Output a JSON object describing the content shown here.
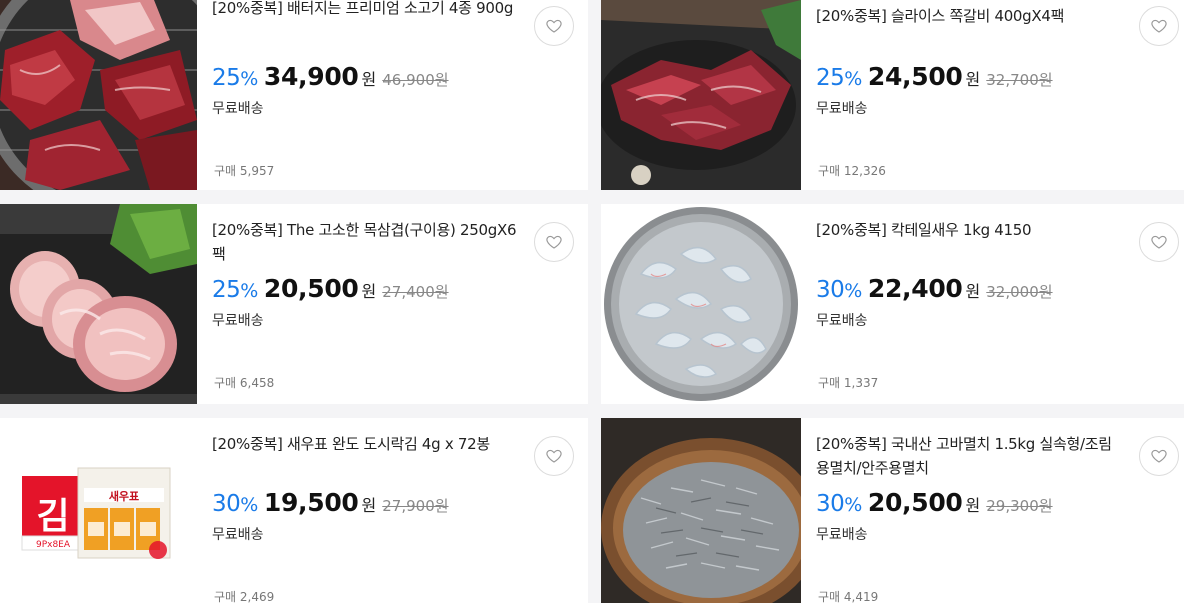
{
  "products": [
    {
      "title": "[20%중복] 배터지는 프리미엄 소고기 4종 900g",
      "discount": "25",
      "discount_unit": "%",
      "price": "34,900",
      "currency": "원",
      "original_price": "46,900원",
      "shipping": "무료배송",
      "purchases": "구매 5,957",
      "image": "beef-grill-image"
    },
    {
      "title": "[20%중복] 슬라이스 쪽갈비 400gX4팩",
      "discount": "25",
      "discount_unit": "%",
      "price": "24,500",
      "currency": "원",
      "original_price": "32,700원",
      "shipping": "무료배송",
      "purchases": "구매 12,326",
      "image": "ribs-image"
    },
    {
      "title": "[20%중복] The 고소한 목삼겹(구이용) 250gX6팩",
      "discount": "25",
      "discount_unit": "%",
      "price": "20,500",
      "currency": "원",
      "original_price": "27,400원",
      "shipping": "무료배송",
      "purchases": "구매 6,458",
      "image": "pork-neck-image"
    },
    {
      "title": "[20%중복] 칵테일새우 1kg 4150",
      "discount": "30",
      "discount_unit": "%",
      "price": "22,400",
      "currency": "원",
      "original_price": "32,000원",
      "shipping": "무료배송",
      "purchases": "구매 1,337",
      "image": "shrimp-bowl-image"
    },
    {
      "title": "[20%중복] 새우표 완도 도시락김 4g x 72봉",
      "discount": "30",
      "discount_unit": "%",
      "price": "19,500",
      "currency": "원",
      "original_price": "27,900원",
      "shipping": "무료배송",
      "purchases": "구매 2,469",
      "image": "seaweed-box-image",
      "box_text": {
        "big": "김",
        "small": "9Px8EA",
        "brand": "새우표"
      }
    },
    {
      "title": "[20%중복] 국내산 고바멸치 1.5kg 실속형/조림용멸치/안주용멸치",
      "discount": "30",
      "discount_unit": "%",
      "price": "20,500",
      "currency": "원",
      "original_price": "29,300원",
      "shipping": "무료배송",
      "purchases": "구매 4,419",
      "image": "anchovy-basket-image"
    }
  ],
  "colors": {
    "discount": "#1a7be8",
    "background": "#f4f4f6",
    "card": "#ffffff"
  },
  "icons": {
    "wishlist": "heart-icon"
  }
}
